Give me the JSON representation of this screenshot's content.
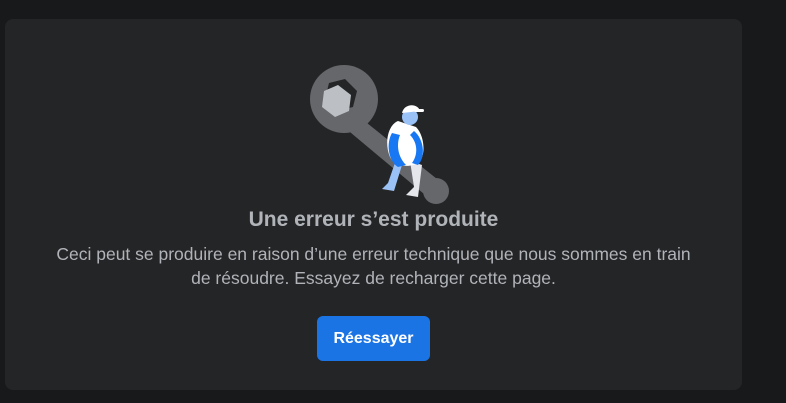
{
  "error": {
    "title": "Une erreur s’est produite",
    "message": "Ceci peut se produire en raison d’une erreur technique que nous sommes en train de résoudre. Essayez de recharger cette page.",
    "retry_label": "Réessayer",
    "illustration": "wrench-with-worker-illustration"
  },
  "colors": {
    "background": "#18191a",
    "card": "#242526",
    "text": "#b0b3b8",
    "button": "#1b74e4",
    "button_text": "#ffffff",
    "wrench": "#65676b",
    "worker_blue": "#1877f2"
  }
}
